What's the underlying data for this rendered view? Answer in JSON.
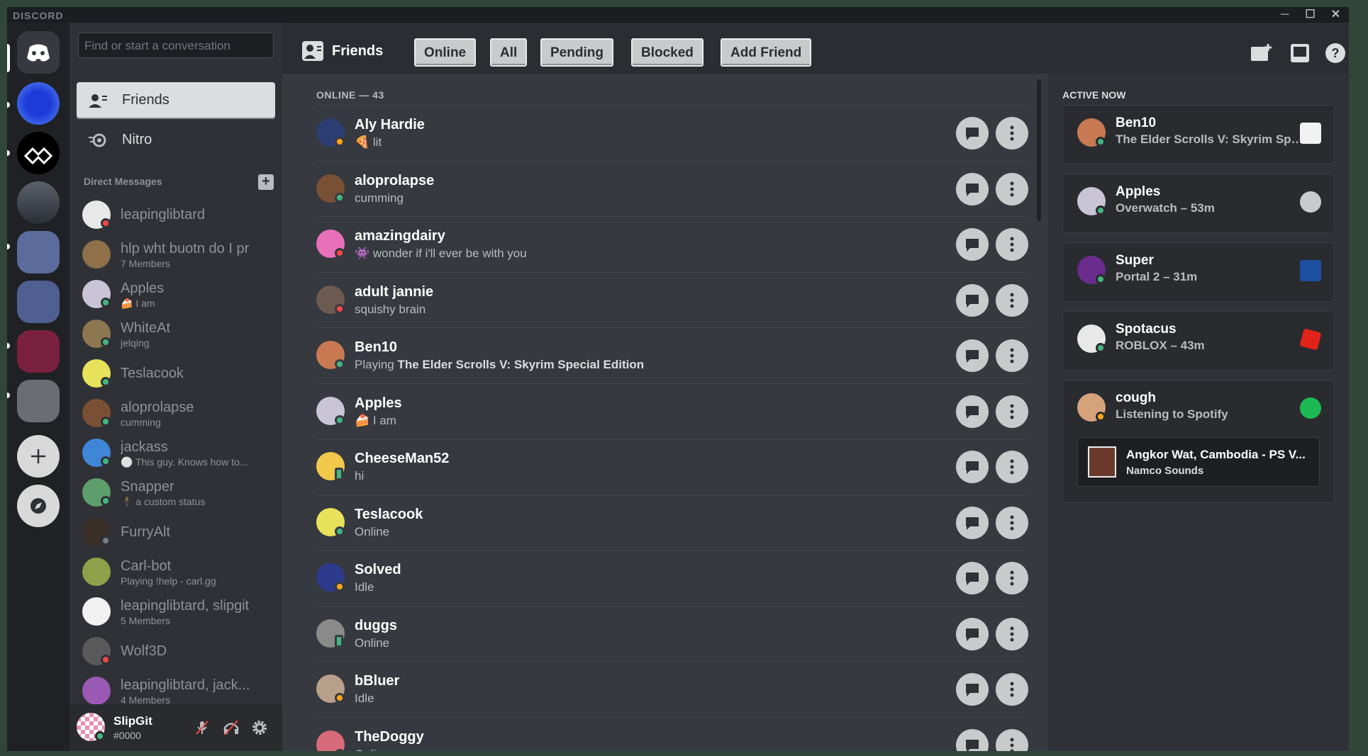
{
  "titlebar": {
    "brand": "DISCORD",
    "minimize": "─",
    "maximize": "☐",
    "close": "✕"
  },
  "search": {
    "placeholder": "Find or start a conversation"
  },
  "nav": [
    {
      "label": "Friends"
    },
    {
      "label": "Nitro"
    }
  ],
  "dm_header": "Direct Messages",
  "dm_add": "+",
  "dms": [
    {
      "name": "leapinglibtard",
      "sub": "",
      "status": "dnd",
      "color": "#e8e8e8"
    },
    {
      "name": "hlp wht buotn do I pr",
      "sub": "7 Members",
      "status": "",
      "color": "#8f7048"
    },
    {
      "name": "Apples",
      "sub": "🍰 I am",
      "status": "online",
      "color": "#c9c4d6"
    },
    {
      "name": "WhiteAt",
      "sub": "jelqing",
      "status": "online",
      "color": "#8d7750"
    },
    {
      "name": "Teslacook",
      "sub": "",
      "status": "online",
      "color": "#e8e15a"
    },
    {
      "name": "aloprolapse",
      "sub": "cumming",
      "status": "online",
      "color": "#7a5034"
    },
    {
      "name": "jackass",
      "sub": "⚪ This guy. Knows how to...",
      "status": "online",
      "color": "#3f86d6"
    },
    {
      "name": "Snapper",
      "sub": "🕴 a custom status",
      "status": "online",
      "color": "#5e9e6c"
    },
    {
      "name": "FurryAlt",
      "sub": "",
      "status": "offline",
      "color": "#3a2e28"
    },
    {
      "name": "Carl-bot",
      "sub": "Playing !help - carl.gg",
      "status": "",
      "color": "#8ea04a"
    },
    {
      "name": "leapinglibtard, slipgit",
      "sub": "5 Members",
      "status": "",
      "color": "#f1f1f1"
    },
    {
      "name": "Wolf3D",
      "sub": "",
      "status": "dnd",
      "color": "#5a5a5a"
    },
    {
      "name": "leapinglibtard, jack...",
      "sub": "4 Members",
      "status": "",
      "color": "#9b59b6"
    }
  ],
  "user": {
    "name": "SlipGit",
    "tag": "#0000"
  },
  "topbar": {
    "title": "Friends",
    "tabs": [
      "Online",
      "All",
      "Pending",
      "Blocked",
      "Add Friend"
    ]
  },
  "list_header": "ONLINE — 43",
  "friends": [
    {
      "name": "Aly Hardie",
      "sub": "🍕 lit",
      "status": "idle",
      "color": "#2c3e73"
    },
    {
      "name": "aloprolapse",
      "sub": "cumming",
      "status": "online",
      "color": "#7a5034"
    },
    {
      "name": "amazingdairy",
      "sub": "👾 wonder if i'll ever be with you",
      "status": "dnd",
      "color": "#e870b8"
    },
    {
      "name": "adult jannie",
      "sub": "squishy brain",
      "status": "dnd",
      "color": "#6c5a50"
    },
    {
      "name": "Ben10",
      "sub_prefix": "Playing ",
      "sub_bold": "The Elder Scrolls V: Skyrim Special Edition",
      "status": "online",
      "color": "#c97a52"
    },
    {
      "name": "Apples",
      "sub": "🍰 I am",
      "status": "online",
      "color": "#c9c4d6"
    },
    {
      "name": "CheeseMan52",
      "sub": "hi",
      "status": "mobile",
      "color": "#f2c84b"
    },
    {
      "name": "Teslacook",
      "sub": "Online",
      "status": "online",
      "color": "#e8e15a"
    },
    {
      "name": "Solved",
      "sub": "Idle",
      "status": "idle",
      "color": "#2d3b8c"
    },
    {
      "name": "duggs",
      "sub": "Online",
      "status": "mobile",
      "color": "#8a8a8a"
    },
    {
      "name": "bBluer",
      "sub": "Idle",
      "status": "idle",
      "color": "#b8a08a"
    },
    {
      "name": "TheDoggy",
      "sub": "Online",
      "status": "online",
      "color": "#d86b7a"
    }
  ],
  "active_title": "ACTIVE NOW",
  "active": [
    {
      "name": "Ben10",
      "sub": "The Elder Scrolls V: Skyrim Special Edition",
      "color": "#c97a52",
      "icon": "skyrim-icon"
    },
    {
      "name": "Apples",
      "sub": "Overwatch – 53m",
      "color": "#c9c4d6",
      "icon": "overwatch-icon"
    },
    {
      "name": "Super",
      "sub": "Portal 2 – 31m",
      "color": "#6a2c8c",
      "icon": "portal-icon"
    },
    {
      "name": "Spotacus",
      "sub": "ROBLOX – 43m",
      "color": "#e8e8e8",
      "icon": "roblox-icon"
    },
    {
      "name": "cough",
      "sub": "Listening to Spotify",
      "color": "#d6a27c",
      "icon": "spotify-icon",
      "track": {
        "title": "Angkor Wat, Cambodia - PS V...",
        "artist": "Namco Sounds"
      }
    }
  ],
  "colors": {
    "accent": "#43b581",
    "dnd": "#f04747",
    "idle": "#faa61a"
  }
}
